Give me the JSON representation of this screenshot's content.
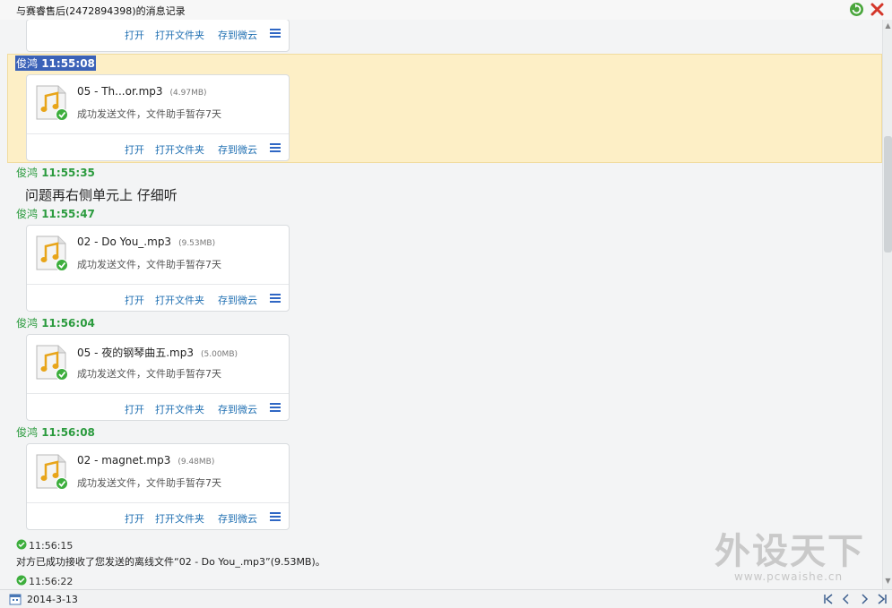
{
  "window": {
    "title": "与赛睿售后(2472894398)的消息记录",
    "refresh_icon": "refresh-icon",
    "close_icon": "close-icon"
  },
  "colors": {
    "sender": "#2b9b3e",
    "link": "#1f6fb2",
    "highlight": "#fdefc6",
    "selection": "#3b62b8",
    "ok": "#3dae3d",
    "music": "#e8a51a"
  },
  "actions": {
    "open": "打开",
    "open_folder": "打开文件夹",
    "save_cloud": "存到微云"
  },
  "messages": [
    {
      "sender": "俊鸿",
      "time": "11:55:08",
      "file": {
        "name": "05 - Th...or.mp3",
        "size": "(4.97MB)",
        "status": "成功发送文件，文件助手暂存7天"
      }
    },
    {
      "sender": "俊鸿",
      "time": "11:55:35",
      "text": "问题再右侧单元上 仔细听"
    },
    {
      "sender": "俊鸿",
      "time": "11:55:47",
      "file": {
        "name": "02 - Do You_.mp3",
        "size": "(9.53MB)",
        "status": "成功发送文件，文件助手暂存7天"
      }
    },
    {
      "sender": "俊鸿",
      "time": "11:56:04",
      "file": {
        "name": "05 - 夜的钢琴曲五.mp3",
        "size": "(5.00MB)",
        "status": "成功发送文件，文件助手暂存7天"
      }
    },
    {
      "sender": "俊鸿",
      "time": "11:56:08",
      "file": {
        "name": "02 - magnet.mp3",
        "size": "(9.48MB)",
        "status": "成功发送文件，文件助手暂存7天"
      }
    }
  ],
  "system": [
    {
      "time": "11:56:15",
      "text": "对方已成功接收了您发送的离线文件“02 - Do You_.mp3”(9.53MB)。"
    },
    {
      "time": "11:56:22"
    }
  ],
  "watermark": {
    "big": "外设天下",
    "url": "www.pcwaishe.cn"
  },
  "footer": {
    "date": "2014-3-13",
    "calendar_icon": "calendar-icon",
    "nav": [
      "first-page-icon",
      "prev-page-icon",
      "next-page-icon",
      "last-page-icon"
    ]
  }
}
